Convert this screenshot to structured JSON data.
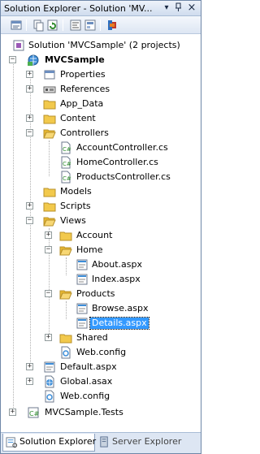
{
  "window": {
    "title": "Solution Explorer - Solution 'MV...",
    "pin_glyph": "▾",
    "close_glyph": "×"
  },
  "toolbar": {
    "buttons": [
      "properties-icon",
      "show-all-files-icon",
      "refresh-icon",
      "view-code-icon",
      "view-designer-icon",
      "class-diagram-icon"
    ]
  },
  "tree": {
    "solution": "Solution 'MVCSample' (2 projects)",
    "project": "MVCSample",
    "properties": "Properties",
    "references": "References",
    "app_data": "App_Data",
    "content": "Content",
    "controllers": "Controllers",
    "account_controller": "AccountController.cs",
    "home_controller": "HomeController.cs",
    "products_controller": "ProductsController.cs",
    "models": "Models",
    "scripts": "Scripts",
    "views": "Views",
    "account": "Account",
    "home": "Home",
    "about": "About.aspx",
    "index": "Index.aspx",
    "products": "Products",
    "browse": "Browse.aspx",
    "details": "Details.aspx",
    "shared": "Shared",
    "views_webconfig": "Web.config",
    "default": "Default.aspx",
    "global": "Global.asax",
    "webconfig": "Web.config",
    "tests": "MVCSample.Tests"
  },
  "tabs": {
    "solution_explorer": "Solution Explorer",
    "server_explorer": "Server Explorer"
  },
  "colors": {
    "selection": "#3399ff",
    "folder": "#f2c94c",
    "titlebar": "#cfdcee"
  }
}
